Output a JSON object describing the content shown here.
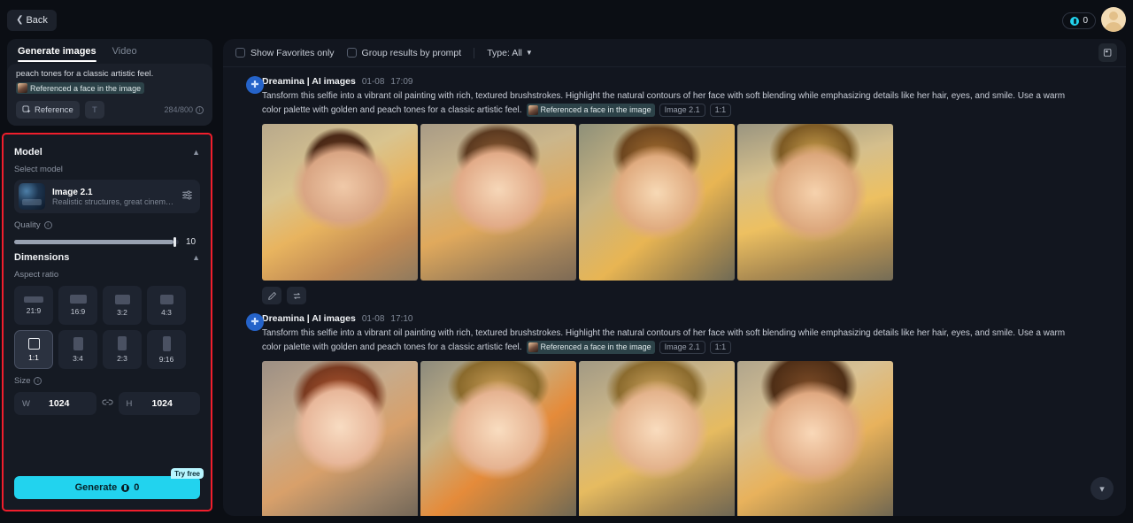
{
  "header": {
    "back_label": "Back",
    "credits_value": "0",
    "credits_icon": "coin-icon",
    "avatar_icon": "user-avatar"
  },
  "sidebar": {
    "tabs": [
      {
        "label": "Generate images",
        "active": true
      },
      {
        "label": "Video",
        "active": false
      }
    ],
    "prompt": {
      "visible_tail": "peach tones for a classic artistic feel.",
      "reference_chip": "Referenced a face in the image",
      "reference_button": "Reference",
      "text_tool_icon": "text-style-icon",
      "char_count": "284/800",
      "info_icon": "info-icon"
    },
    "model_section": {
      "title": "Model",
      "collapse_icon": "chevron-up-icon",
      "select_label": "Select model",
      "model_name": "Image 2.1",
      "model_desc": "Realistic structures, great cinematog...",
      "settings_icon": "sliders-icon"
    },
    "quality_section": {
      "label": "Quality",
      "info_icon": "info-icon",
      "value": "10",
      "fill_percent": 97
    },
    "dimensions_section": {
      "title": "Dimensions",
      "collapse_icon": "chevron-up-icon",
      "aspect_label": "Aspect ratio",
      "ratios": [
        {
          "label": "21:9",
          "w": 22,
          "h": 7,
          "selected": false
        },
        {
          "label": "16:9",
          "w": 19,
          "h": 10,
          "selected": false
        },
        {
          "label": "3:2",
          "w": 17,
          "h": 11,
          "selected": false
        },
        {
          "label": "4:3",
          "w": 15,
          "h": 11,
          "selected": false
        },
        {
          "label": "1:1",
          "w": 13,
          "h": 13,
          "selected": true
        },
        {
          "label": "3:4",
          "w": 11,
          "h": 15,
          "selected": false
        },
        {
          "label": "2:3",
          "w": 10,
          "h": 16,
          "selected": false
        },
        {
          "label": "9:16",
          "w": 9,
          "h": 17,
          "selected": false
        }
      ],
      "size_label": "Size",
      "size_info_icon": "info-icon",
      "width_key": "W",
      "width_value": "1024",
      "link_icon": "link-icon",
      "height_key": "H",
      "height_value": "1024"
    },
    "generate": {
      "label": "Generate",
      "cost": "0",
      "coin_icon": "coin-icon",
      "badge": "Try free"
    }
  },
  "toolbar": {
    "favorites_label": "Show Favorites only",
    "favorites_checked": false,
    "group_label": "Group results by prompt",
    "group_checked": false,
    "type_label": "Type: All",
    "type_chevron_icon": "chevron-down-icon",
    "gallery_icon": "gallery-icon"
  },
  "feed": {
    "scroll_down_icon": "chevron-down-icon",
    "results": [
      {
        "avatar_icon": "dreamina-logo-icon",
        "author": "Dreamina | AI images",
        "date": "01-08",
        "time": "17:09",
        "prompt": "Tansform this selfie into a vibrant oil painting with rich, textured brushstrokes. Highlight the natural contours of her face with soft blending while emphasizing details like her hair, eyes, and smile. Use a warm color palette with golden and peach tones for a classic artistic feel.",
        "reference_chip": "Referenced a face in the image",
        "model_chip": "Image 2.1",
        "ratio_chip": "1:1",
        "images": [
          "p1",
          "p2",
          "p3",
          "p4"
        ],
        "actions": [
          {
            "name": "edit-button",
            "icon": "pencil-icon"
          },
          {
            "name": "regenerate-button",
            "icon": "swap-arrows-icon"
          }
        ]
      },
      {
        "avatar_icon": "dreamina-logo-icon",
        "author": "Dreamina | AI images",
        "date": "01-08",
        "time": "17:10",
        "prompt": "Tansform this selfie into a vibrant oil painting with rich, textured brushstrokes. Highlight the natural contours of her face with soft blending while emphasizing details like her hair, eyes, and smile. Use a warm color palette with golden and peach tones for a classic artistic feel.",
        "reference_chip": "Referenced a face in the image",
        "model_chip": "Image 2.1",
        "ratio_chip": "1:1",
        "images": [
          "p5",
          "p6",
          "p7",
          "p8"
        ],
        "actions": []
      }
    ]
  },
  "colors": {
    "accent": "#22d3ee",
    "highlight_box": "#f01e2c",
    "panel_bg": "#151a23",
    "page_bg": "#0b0e14"
  }
}
